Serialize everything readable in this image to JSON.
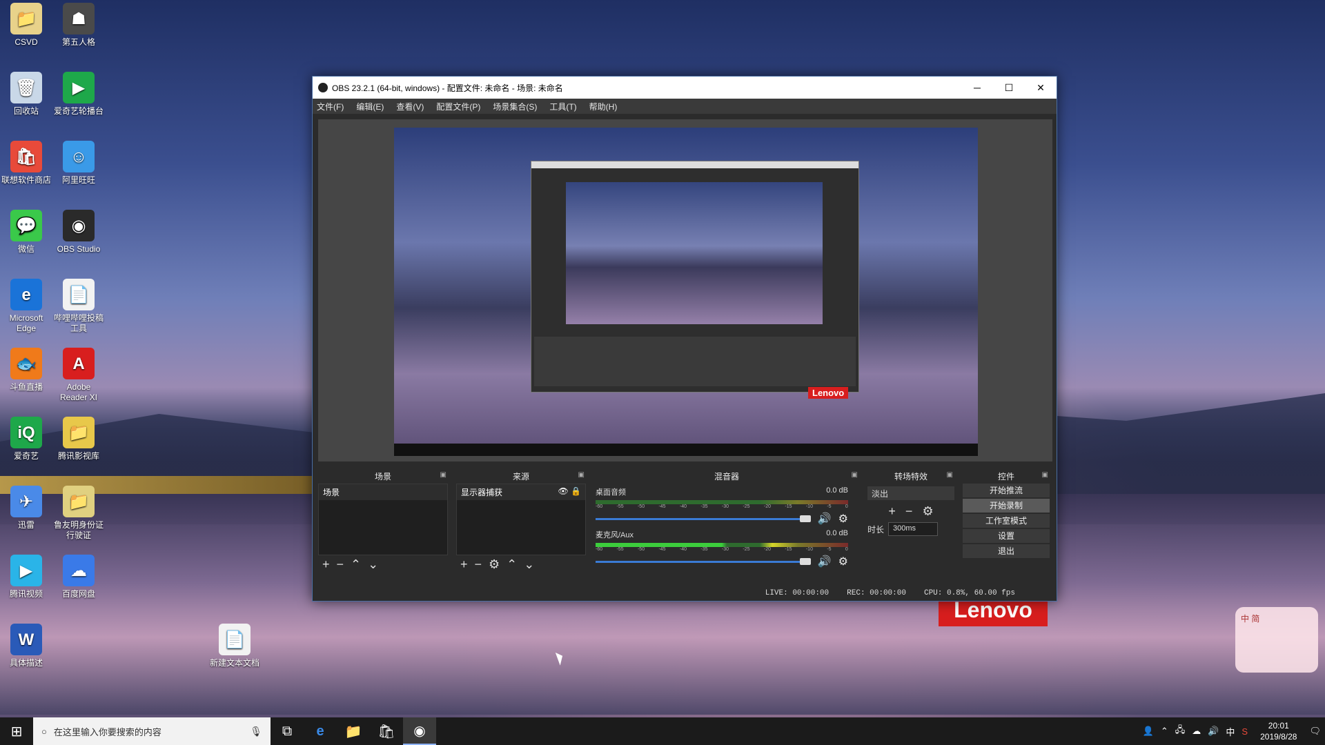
{
  "desktop": {
    "icons": [
      {
        "label": "CSVD",
        "glyph": "📁",
        "color": "#e8d28a"
      },
      {
        "label": "第五人格",
        "glyph": "☗",
        "color": "#4a4a4a"
      },
      {
        "label": "回收站",
        "glyph": "🗑",
        "color": "#c9d8e8"
      },
      {
        "label": "爱奇艺轮播台",
        "glyph": "▶",
        "color": "#1ea84a"
      },
      {
        "label": "联想软件商店",
        "glyph": "🛍",
        "color": "#e84a3a"
      },
      {
        "label": "阿里旺旺",
        "glyph": "☺",
        "color": "#3a9ae8"
      },
      {
        "label": "微信",
        "glyph": "💬",
        "color": "#3ac94a"
      },
      {
        "label": "OBS Studio",
        "glyph": "◉",
        "color": "#2a2a2a"
      },
      {
        "label": "Microsoft Edge",
        "glyph": "e",
        "color": "#1a73d8"
      },
      {
        "label": "哔哩哔哩投稿工具",
        "glyph": "📄",
        "color": "#f2f2f2"
      },
      {
        "label": "斗鱼直播",
        "glyph": "🐟",
        "color": "#f07a1a"
      },
      {
        "label": "Adobe Reader XI",
        "glyph": "A",
        "color": "#d81e1e"
      },
      {
        "label": "爱奇艺",
        "glyph": "iQ",
        "color": "#1ea84a"
      },
      {
        "label": "腾讯影视库",
        "glyph": "📁",
        "color": "#e8c84a"
      },
      {
        "label": "迅雷",
        "glyph": "✈",
        "color": "#4a8ae8"
      },
      {
        "label": "鲁友明身份证行驶证",
        "glyph": "📁",
        "color": "#e0d080"
      },
      {
        "label": "腾讯视频",
        "glyph": "▶",
        "color": "#2ab4e8"
      },
      {
        "label": "百度网盘",
        "glyph": "☁",
        "color": "#3a7ae8"
      },
      {
        "label": "具体描述",
        "glyph": "W",
        "color": "#2a5ab8"
      },
      {
        "label": "新建文本文档",
        "glyph": "📄",
        "color": "#f2f2f2"
      }
    ]
  },
  "obs": {
    "title": "OBS 23.2.1 (64-bit, windows) - 配置文件: 未命名 - 场景: 未命名",
    "menu": [
      "文件(F)",
      "编辑(E)",
      "查看(V)",
      "配置文件(P)",
      "场景集合(S)",
      "工具(T)",
      "帮助(H)"
    ],
    "win_minimize": "─",
    "win_maximize": "☐",
    "win_close": "✕",
    "docks": {
      "scenes": {
        "title": "场景",
        "items": [
          "场景"
        ]
      },
      "sources": {
        "title": "来源",
        "items": [
          "显示器捕获"
        ]
      },
      "mixer": {
        "title": "混音器",
        "tracks": [
          {
            "name": "桌面音频",
            "db": "0.0 dB"
          },
          {
            "name": "麦克风/Aux",
            "db": "0.0 dB"
          }
        ],
        "ticks": [
          "-60",
          "-55",
          "-50",
          "-45",
          "-40",
          "-35",
          "-30",
          "-25",
          "-20",
          "-15",
          "-10",
          "-5",
          "0"
        ]
      },
      "transitions": {
        "title": "转场特效",
        "selected": "淡出",
        "duration_label": "时长",
        "duration_value": "300ms"
      },
      "controls": {
        "title": "控件",
        "buttons": [
          "开始推流",
          "开始录制",
          "工作室模式",
          "设置",
          "退出"
        ]
      }
    },
    "status": {
      "live": "LIVE: 00:00:00",
      "rec": "REC: 00:00:00",
      "cpu": "CPU: 0.8%, 60.00 fps"
    },
    "preview_brand": "Lenovo"
  },
  "wallpaper": {
    "brand": "Lenovo",
    "mascot_text": "中\n简"
  },
  "taskbar": {
    "search_placeholder": "在这里输入你要搜索的内容",
    "time": "20:01",
    "date": "2019/8/28",
    "ime": "中"
  }
}
